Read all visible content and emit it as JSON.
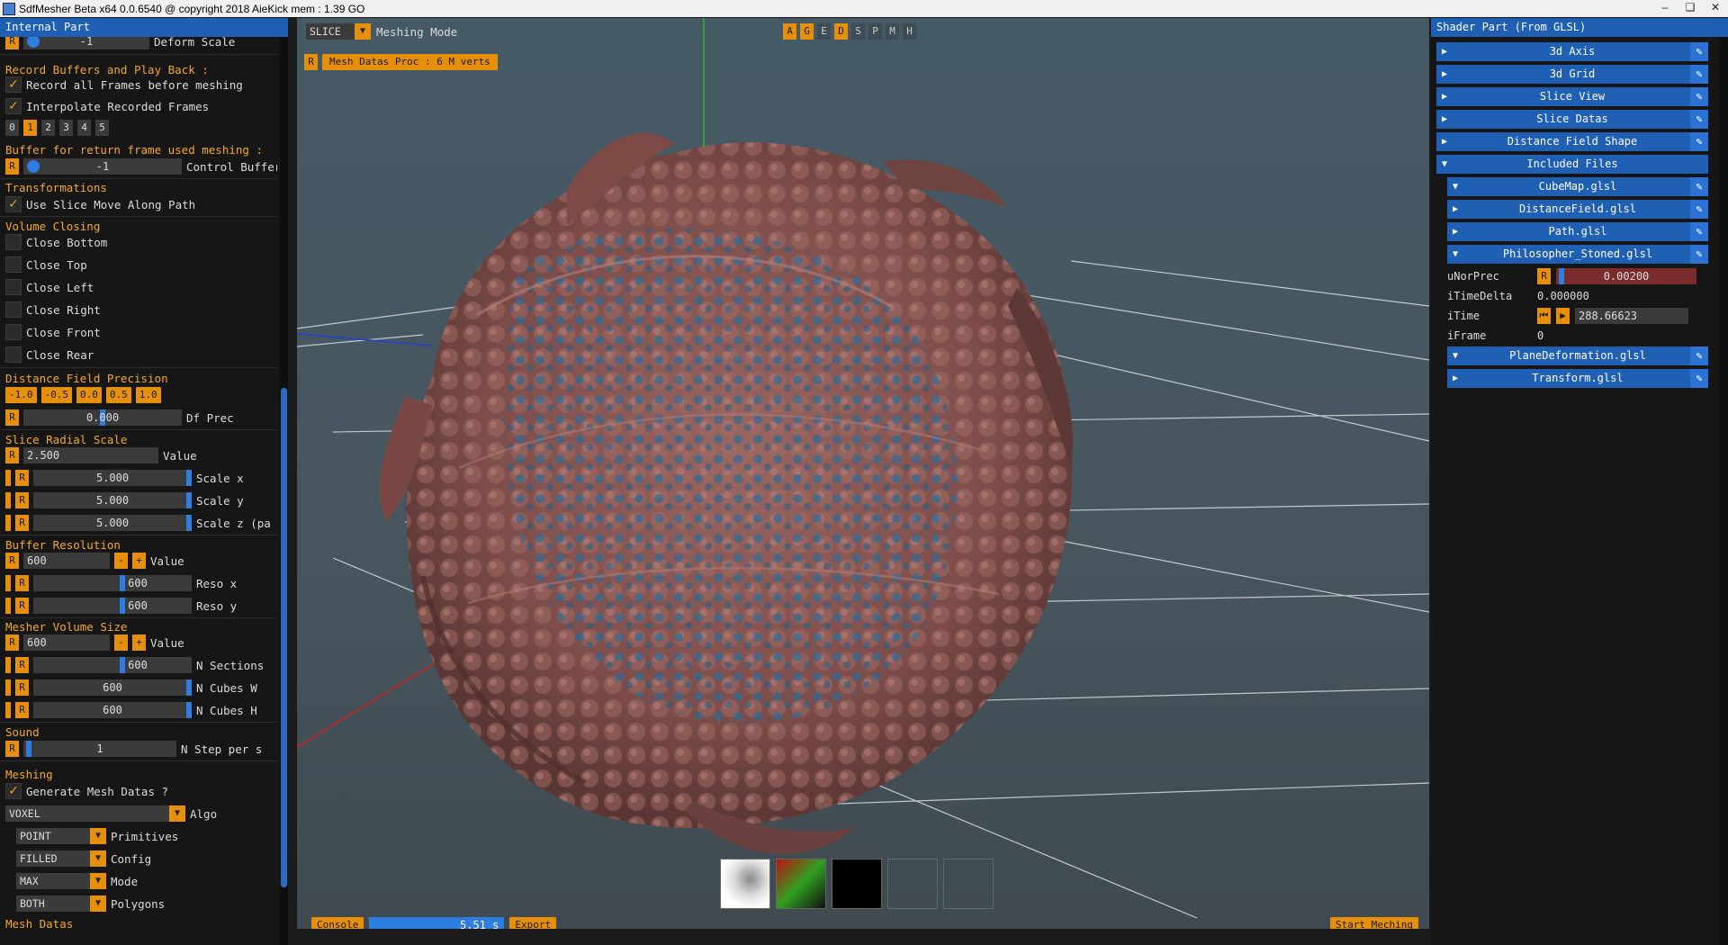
{
  "window": {
    "title": "SdfMesher Beta x64 0.0.6540 @ copyright 2018 AieKick mem : 1.39 GO",
    "controls": [
      "–",
      "❏",
      "✕"
    ]
  },
  "left": {
    "header": "Internal Part",
    "top_row": {
      "value": "-1",
      "label": "Deform Scale"
    },
    "record": {
      "title": "Record Buffers and Play Back :",
      "record_all": "Record all Frames before meshing",
      "interpolate": "Interpolate Recorded Frames",
      "numbers": [
        "0",
        "1",
        "2",
        "3",
        "4",
        "5"
      ],
      "selected": "1",
      "buffer_title": "Buffer for return frame used meshing :",
      "control_value": "-1",
      "control_label": "Control Buffer"
    },
    "transformations": {
      "title": "Transformations",
      "slice_move": "Use Slice Move Along Path"
    },
    "volume_closing": {
      "title": "Volume Closing",
      "items": [
        "Close Bottom",
        "Close Top",
        "Close Left",
        "Close Right",
        "Close Front",
        "Close Rear"
      ]
    },
    "df_precision": {
      "title": "Distance Field Precision",
      "buttons": [
        "-1.0",
        "-0.5",
        "0.0",
        "0.5",
        "1.0"
      ],
      "value": "0.000",
      "label": "Df Prec"
    },
    "slice_radial": {
      "title": "Slice Radial Scale",
      "value": "2.500",
      "value_label": "Value",
      "scale_x": "5.000",
      "scale_x_label": "Scale x",
      "scale_y": "5.000",
      "scale_y_label": "Scale y",
      "scale_z": "5.000",
      "scale_z_label": "Scale z (pa"
    },
    "buffer_res": {
      "title": "Buffer Resolution",
      "value": "600",
      "value_label": "Value",
      "reso_x": "600",
      "reso_x_label": "Reso x",
      "reso_y": "600",
      "reso_y_label": "Reso y"
    },
    "mesher_volume": {
      "title": "Mesher Volume Size",
      "value": "600",
      "value_label": "Value",
      "n_sections": "600",
      "n_sections_label": "N Sections",
      "n_cubes_w": "600",
      "n_cubes_w_label": "N Cubes W",
      "n_cubes_h": "600",
      "n_cubes_h_label": "N Cubes H"
    },
    "sound": {
      "title": "Sound",
      "value": "1",
      "label": "N Step per s"
    },
    "meshing": {
      "title": "Meshing",
      "generate": "Generate Mesh Datas ?",
      "algo": "VOXEL",
      "algo_label": "Algo",
      "primitives": "POINT",
      "primitives_label": "Primitives",
      "config": "FILLED",
      "config_label": "Config",
      "mode": "MAX",
      "mode_label": "Mode",
      "polygons": "BOTH",
      "polygons_label": "Polygons",
      "cut_label": "Mesh Datas"
    },
    "reset": "R",
    "minus": "-",
    "plus": "+"
  },
  "viewport": {
    "mode_combo": "SLICE",
    "mode_label": "Meshing Mode",
    "toggles": [
      "A",
      "G",
      "E",
      "D",
      "S",
      "P",
      "M",
      "H"
    ],
    "toggles_on": [
      true,
      true,
      false,
      true,
      false,
      false,
      false,
      false
    ],
    "proc_label": "Mesh Datas Proc : 6 M verts",
    "console": "Console",
    "time": "5.51 s",
    "export": "Export",
    "start": "Start Meching",
    "colors": {
      "bg": "#47555d",
      "mesh": "#8d5a55",
      "mesh_blue": "#2c6b98",
      "axis_x": "#d02020",
      "axis_y": "#20c020",
      "axis_z": "#2040d0"
    }
  },
  "right": {
    "header": "Shader Part (From GLSL)",
    "nodes": [
      "3d Axis",
      "3d Grid",
      "Slice View",
      "Slice Datas",
      "Distance Field Shape",
      "Included Files"
    ],
    "files": [
      "CubeMap.glsl",
      "DistanceField.glsl",
      "Path.glsl",
      "Philosopher_Stoned.glsl"
    ],
    "uniforms": {
      "unorprec_label": "uNorPrec",
      "unorprec": "0.00200",
      "itimedelta_label": "iTimeDelta",
      "itimedelta": "0.000000",
      "itime_label": "iTime",
      "itime": "288.66623",
      "iframe_label": "iFrame",
      "iframe": "0"
    },
    "files_after": [
      "PlaneDeformation.glsl",
      "Transform.glsl"
    ]
  }
}
